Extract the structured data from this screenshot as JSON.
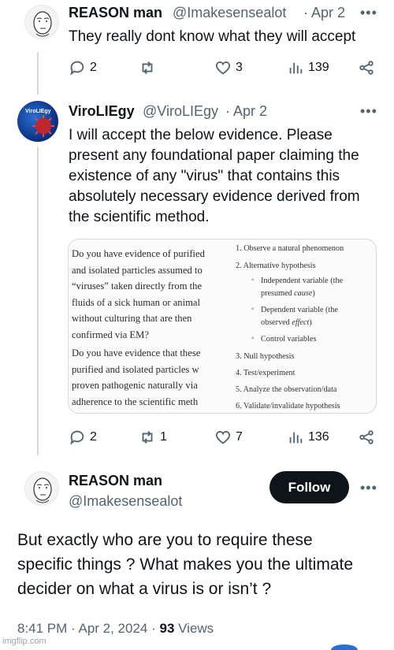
{
  "tweet1": {
    "name": "REASON man",
    "handle": "@Imakesensealot",
    "date": "· Apr 2",
    "text": "They really dont know what they will accept",
    "replies": "2",
    "retweets": "",
    "likes": "3",
    "views": "139"
  },
  "tweet2": {
    "name": "ViroLIEgy",
    "handle": "@ViroLIEgy",
    "date": "· Apr 2",
    "avatar_label": "ViroLIEgy",
    "text": "I will accept the below evidence. Please present any foundational paper claiming the existence of any \"virus\" that contains this absolutely necessary evidence derived from the scientific method.",
    "image": {
      "left_lines": [
        "Do you have evidence of purified",
        "and isolated particles assumed to",
        "“viruses” taken directly from the",
        "fluids of a sick human or animal",
        "without culturing that are then",
        "confirmed via EM?",
        "Do you have evidence that these",
        "purified and isolated particles w",
        "proven pathogenic naturally via",
        "adherence to the scientific meth"
      ],
      "steps": [
        "1.  Observe a natural phenomenon",
        "2.  Alternative hypothesis",
        "3.  Null hypothesis",
        "4.  Test/experiment",
        "5.  Analyze the observation/data",
        "6.  Validate/invalidate hypothesis"
      ],
      "sub_steps": [
        "Independent variable (the",
        "presumed cause)",
        "Dependent variable (the",
        "observed effect)",
        "Control variables"
      ]
    },
    "replies": "2",
    "retweets": "1",
    "likes": "7",
    "views": "136"
  },
  "tweet3": {
    "name": "REASON man",
    "handle": "@Imakesensealot",
    "follow_label": "Follow",
    "text": "But exactly who are you to require these specific things ? What makes you the ultimate decider on what a virus is or isn’t ?",
    "time": "8:41 PM · Apr 2, 2024 · ",
    "views_count": "93",
    "views_label": " Views"
  },
  "watermark": "imgflip.com",
  "more_label": "•••",
  "colors": {
    "text": "#0f1419",
    "secondary": "#536471",
    "line": "#cfd9de",
    "button": "#0f1419"
  }
}
